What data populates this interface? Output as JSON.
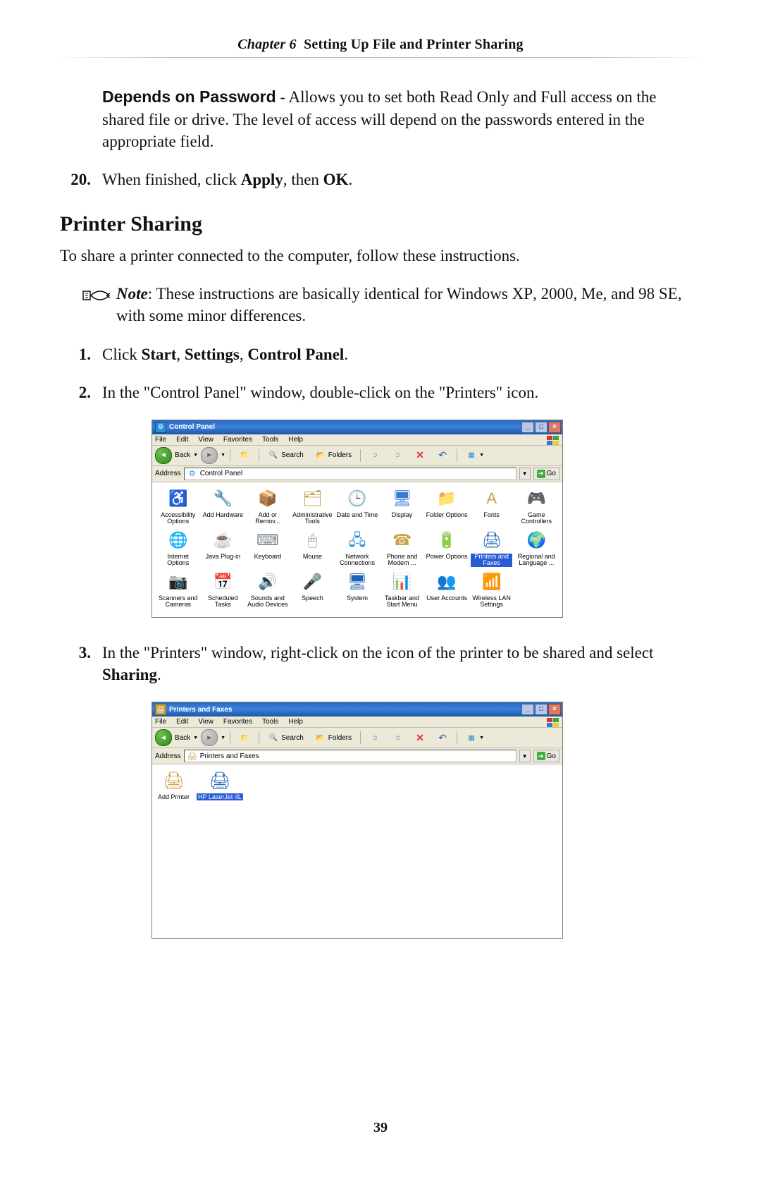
{
  "header": {
    "chapter": "Chapter 6",
    "title": "Setting Up File and Printer Sharing"
  },
  "dependsOn": {
    "lead": "Depends on Password",
    "text": " - Allows you to set both Read Only and Full access on the shared file or drive. The level of access will depend on the passwords entered in the appropriate field."
  },
  "step20": {
    "num": "20.",
    "pre": "When finished, click ",
    "b1": "Apply",
    "mid": ", then ",
    "b2": "OK",
    "post": "."
  },
  "section": "Printer Sharing",
  "intro": "To share a printer connected to the computer, follow these instructions.",
  "note": {
    "label": "Note",
    "body1": ": These instructions are basically identical for Windows ",
    "xp": "XP",
    "body2": ", 2000, Me, and 98 ",
    "se": "SE",
    "body3": ", with some minor differences."
  },
  "steps": {
    "s1": {
      "num": "1.",
      "pre": "Click ",
      "b1": "Start",
      "c1": ", ",
      "b2": "Settings",
      "c2": ", ",
      "b3": "Control Panel",
      "post": "."
    },
    "s2": {
      "num": "2.",
      "text": "In the \"Control Panel\" window, double-click on the \"Printers\" icon."
    },
    "s3": {
      "num": "3.",
      "pre": "In the \"Printers\" window, right-click on the icon of the printer to be shared and select ",
      "b1": "Sharing",
      "post": "."
    }
  },
  "ui": {
    "menu": {
      "file": "File",
      "edit": "Edit",
      "view": "View",
      "favorites": "Favorites",
      "tools": "Tools",
      "help": "Help"
    },
    "toolbar": {
      "back": "Back",
      "search": "Search",
      "folders": "Folders"
    },
    "addr": {
      "label": "Address",
      "go": "Go"
    }
  },
  "scr1": {
    "title": "Control Panel",
    "addressText": "Control Panel",
    "icons": [
      {
        "n": "Accessibility Options",
        "c": "#2c8b1e",
        "s": "♿"
      },
      {
        "n": "Add Hardware",
        "c": "#1e64b4",
        "s": "🔧"
      },
      {
        "n": "Add or Remov...",
        "c": "#c99a2e",
        "s": "📦"
      },
      {
        "n": "Administrative Tools",
        "c": "#caa24a",
        "s": "🗂"
      },
      {
        "n": "Date and Time",
        "c": "#3a7bd5",
        "s": "🕒"
      },
      {
        "n": "Display",
        "c": "#3a7bd5",
        "s": "🖥"
      },
      {
        "n": "Folder Options",
        "c": "#caa24a",
        "s": "📁"
      },
      {
        "n": "Fonts",
        "c": "#caa24a",
        "s": "A"
      },
      {
        "n": "Game Controllers",
        "c": "#6b8e9e",
        "s": "🎮"
      },
      {
        "n": "Internet Options",
        "c": "#2b90d9",
        "s": "🌐"
      },
      {
        "n": "Java Plug-in",
        "c": "#1e64b4",
        "s": "☕"
      },
      {
        "n": "Keyboard",
        "c": "#7a8690",
        "s": "⌨"
      },
      {
        "n": "Mouse",
        "c": "#7a8690",
        "s": "🖱"
      },
      {
        "n": "Network Connections",
        "c": "#2b90d9",
        "s": "🖧"
      },
      {
        "n": "Phone and Modem ...",
        "c": "#caa24a",
        "s": "☎"
      },
      {
        "n": "Power Options",
        "c": "#2c8b1e",
        "s": "🔋"
      },
      {
        "n": "Printers and Faxes",
        "c": "#1e64b4",
        "s": "🖨",
        "sel": true
      },
      {
        "n": "Regional and Language ...",
        "c": "#2b90d9",
        "s": "🌍"
      },
      {
        "n": "Scanners and Cameras",
        "c": "#7a8690",
        "s": "📷"
      },
      {
        "n": "Scheduled Tasks",
        "c": "#caa24a",
        "s": "📅"
      },
      {
        "n": "Sounds and Audio Devices",
        "c": "#7a8690",
        "s": "🔊"
      },
      {
        "n": "Speech",
        "c": "#7a8690",
        "s": "🎤"
      },
      {
        "n": "System",
        "c": "#1e64b4",
        "s": "🖥"
      },
      {
        "n": "Taskbar and Start Menu",
        "c": "#2b90d9",
        "s": "📊"
      },
      {
        "n": "User Accounts",
        "c": "#5a9e5a",
        "s": "👥"
      },
      {
        "n": "Wireless LAN Settings",
        "c": "#2b90d9",
        "s": "📶"
      }
    ]
  },
  "scr2": {
    "title": "Printers and Faxes",
    "addressText": "Printers and Faxes",
    "items": [
      {
        "n": "Add Printer",
        "s": "🖨",
        "c": "#caa24a"
      },
      {
        "n": "HP LaserJet 4L",
        "s": "🖨",
        "c": "#1e64b4",
        "sel": true
      }
    ]
  },
  "pageNumber": "39"
}
